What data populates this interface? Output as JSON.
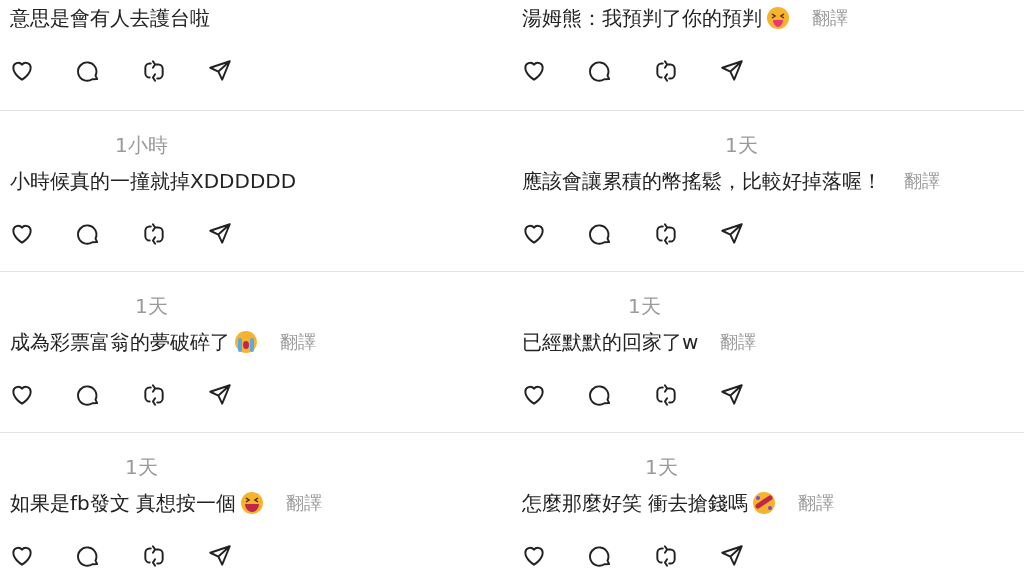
{
  "comments": [
    {
      "text": "意思是會有人去護台啦"
    },
    {
      "text": "湯姆熊：我預判了你的預判",
      "emoji": {
        "kind": "tongue"
      },
      "translate": "翻譯"
    },
    {
      "time": "1小時",
      "text": "小時候真的一撞就掉XDDDDDD"
    },
    {
      "time": "1天",
      "text": "應該會讓累積的幣搖鬆，比較好掉落喔！",
      "translate": "翻譯"
    },
    {
      "time": "1天",
      "text": "成為彩票富翁的夢破碎了",
      "emoji": {
        "kind": "cry"
      },
      "translate": "翻譯"
    },
    {
      "time": "1天",
      "text": "已經默默的回家了w",
      "translate": "翻譯"
    },
    {
      "time": "1天",
      "text": "如果是fb發文 真想按一個",
      "emoji": {
        "kind": "grin"
      },
      "translate": "翻譯"
    },
    {
      "time": "1天",
      "text": "怎麼那麼好笑 衝去搶錢嗎",
      "emoji": {
        "kind": "rofl"
      },
      "translate": "翻譯"
    }
  ]
}
